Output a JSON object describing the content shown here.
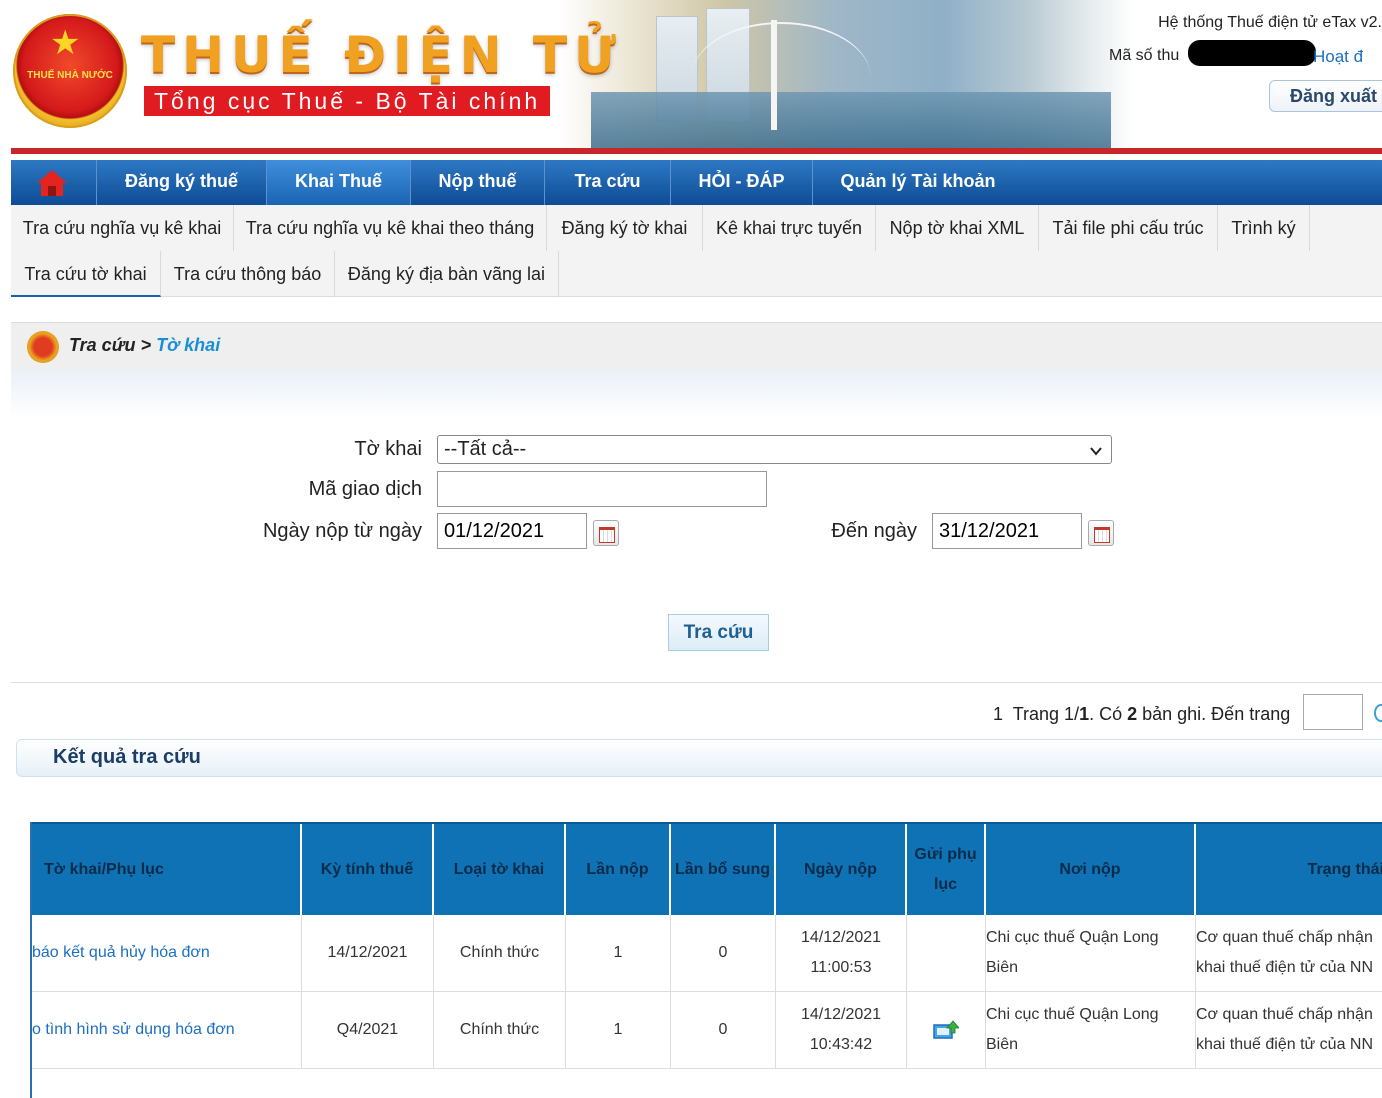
{
  "header": {
    "brand_title": "THUẾ ĐIỆN TỬ",
    "brand_subtitle": "Tổng cục Thuế - Bộ Tài chính",
    "emblem_text": "THUẾ NHÀ NƯỚC",
    "system_name": "Hệ thống Thuế điện tử eTax v2.",
    "taxcode_label": "Mã số thu",
    "status": "Hoạt đ",
    "logout": "Đăng xuất"
  },
  "mainnav": [
    "Đăng ký thuế",
    "Khai Thuế",
    "Nộp thuế",
    "Tra cứu",
    "HỎI - ĐÁP",
    "Quản lý Tài khoản"
  ],
  "subnav_row1": [
    "Tra cứu nghĩa vụ kê khai",
    "Tra cứu nghĩa vụ kê khai theo tháng",
    "Đăng ký tờ khai",
    "Kê khai trực tuyến",
    "Nộp tờ khai XML",
    "Tải file phi cấu trúc",
    "Trình ký"
  ],
  "subnav_row2": [
    "Tra cứu tờ khai",
    "Tra cứu thông báo",
    "Đăng ký địa bàn vãng lai"
  ],
  "breadcrumb": {
    "parent": "Tra cứu",
    "sep": ">",
    "current": "Tờ khai"
  },
  "form": {
    "tokhai_label": "Tờ khai",
    "tokhai_value": "--Tất cả--",
    "magiaodich_label": "Mã giao dịch",
    "magiaodich_value": "",
    "from_label": "Ngày nộp từ ngày",
    "from_value": "01/12/2021",
    "to_label": "Đến ngày",
    "to_value": "31/12/2021",
    "search_button": "Tra cứu"
  },
  "pager": {
    "page_link": "1",
    "text_a": "Trang 1/",
    "total_pages": "1",
    "text_b": ". Có ",
    "records": "2",
    "text_c": " bản ghi. Đến trang"
  },
  "results": {
    "title": "Kết quả tra cứu",
    "columns": [
      "Tờ khai/Phụ lục",
      "Kỳ tính thuế",
      "Loại tờ khai",
      "Lần nộp",
      "Lần bổ sung",
      "Ngày nộp",
      "Gửi phụ lục",
      "Nơi nộp",
      "Trạng thái"
    ],
    "rows": [
      {
        "tokhai": "báo kết quả hủy hóa đơn",
        "ky": "14/12/2021",
        "loai": "Chính thức",
        "lan_nop": "1",
        "lan_bs": "0",
        "ngay": "14/12/2021",
        "gio": "11:00:53",
        "noi_nop_1": "Chi cục thuế Quận Long",
        "noi_nop_2": "Biên",
        "trang_thai_1": "Cơ quan thuế chấp nhận",
        "trang_thai_2": "khai thuế điện tử của NN"
      },
      {
        "tokhai": "o tình hình sử dụng hóa đơn",
        "ky": "Q4/2021",
        "loai": "Chính thức",
        "lan_nop": "1",
        "lan_bs": "0",
        "ngay": "14/12/2021",
        "gio": "10:43:42",
        "noi_nop_1": "Chi cục thuế Quận Long",
        "noi_nop_2": "Biên",
        "trang_thai_1": "Cơ quan thuế chấp nhận",
        "trang_thai_2": "khai thuế điện tử của NN"
      }
    ]
  },
  "colors": {
    "nav_blue": "#0e4c95",
    "header_red": "#c9262a",
    "table_head": "#0f72b4",
    "link": "#1b6fc3"
  }
}
